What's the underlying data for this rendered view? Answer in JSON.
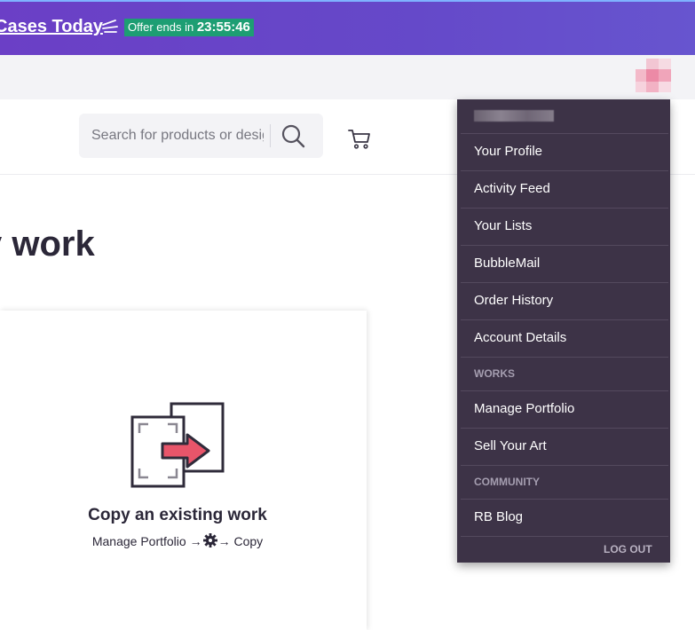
{
  "promo": {
    "link_text": "Cases Today",
    "timer_label": "Offer ends in",
    "timer_value": "23:55:46"
  },
  "search": {
    "placeholder": "Search for products or designs"
  },
  "main": {
    "page_title": "y work",
    "card": {
      "title": "Copy an existing work",
      "hint_start": "Manage Portfolio →",
      "hint_end": "→ Copy"
    }
  },
  "dropdown": {
    "items": [
      "Your Profile",
      "Activity Feed",
      "Your Lists",
      "BubbleMail",
      "Order History",
      "Account Details"
    ],
    "section_works": "WORKS",
    "works_items": [
      "Manage Portfolio",
      "Sell Your Art"
    ],
    "section_community": "COMMUNITY",
    "community_items": [
      "RB Blog"
    ],
    "logout": "LOG OUT"
  },
  "colors": {
    "banner": "#6b3fc6",
    "timer_badge": "#1d9e73",
    "dropdown_bg": "#3d3347",
    "illustration_arrow": "#e8556a"
  },
  "icons": [
    "sparkle-icon",
    "search-icon",
    "cart-icon",
    "copy-work-icon",
    "gear-icon",
    "avatar"
  ]
}
